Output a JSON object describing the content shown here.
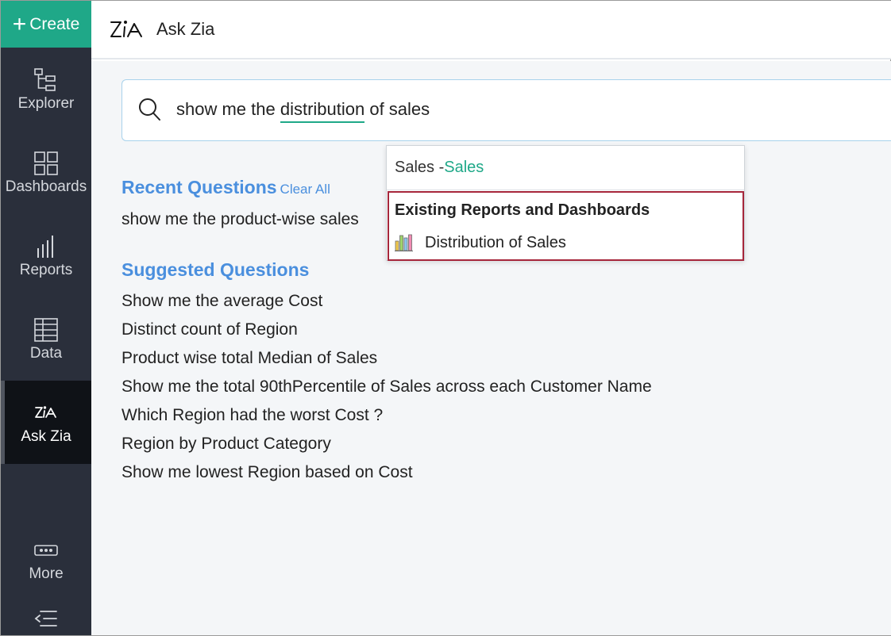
{
  "sidebar": {
    "create_label": "Create",
    "items": [
      {
        "label": "Explorer",
        "icon": "explorer-icon"
      },
      {
        "label": "Dashboards",
        "icon": "dashboards-icon"
      },
      {
        "label": "Reports",
        "icon": "reports-icon"
      },
      {
        "label": "Data",
        "icon": "data-icon"
      },
      {
        "label": "Ask Zia",
        "icon": "zia-icon",
        "active": true
      },
      {
        "label": "More",
        "icon": "more-icon"
      }
    ],
    "collapse_icon": "collapse-menu-icon"
  },
  "header": {
    "title": "Ask Zia",
    "logo_icon": "zia-logo-icon"
  },
  "search": {
    "query_before": "show me the ",
    "query_highlight": "distribution",
    "query_after": " of sales",
    "highlight_color": "#1fa888"
  },
  "dropdown": {
    "column_prefix": "Sales - ",
    "column_name": "Sales",
    "section_title": "Existing Reports and Dashboards",
    "items": [
      {
        "label": "Distribution of Sales",
        "icon": "bar-chart-icon"
      }
    ],
    "section_border_color": "#a6263b"
  },
  "recent": {
    "title": "Recent Questions",
    "clear_label": "Clear All",
    "items": [
      "show me the product-wise sales"
    ]
  },
  "suggested": {
    "title": "Suggested Questions",
    "items": [
      "Show me the average Cost",
      "Distinct count of Region",
      "Product wise total Median of Sales",
      "Show me the total 90thPercentile of Sales across each Customer Name",
      "Which Region had the worst Cost ?",
      "Region by Product Category",
      "Show me lowest Region based on Cost"
    ]
  },
  "colors": {
    "brand_green": "#1fa888",
    "sidebar_bg": "#2a2f3b",
    "link_blue": "#4a8fde"
  }
}
